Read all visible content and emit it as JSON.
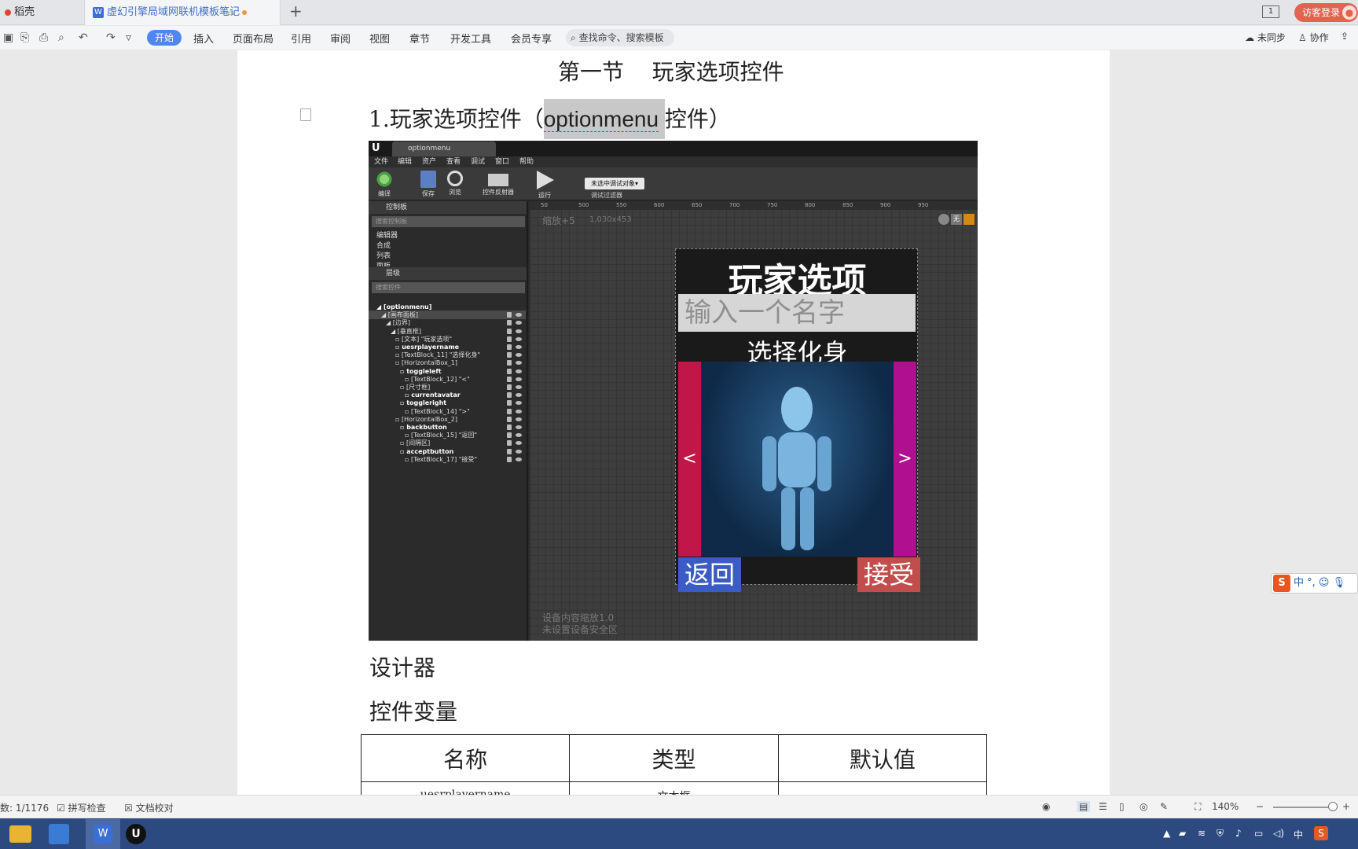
{
  "tabs": {
    "home": "稻壳",
    "doc": "虚幻引擎局域网联机模板笔记",
    "new_tab": "+"
  },
  "titlebar": {
    "window_count": "1",
    "visitor_login": "访客登录"
  },
  "ribbon": {
    "tabs": [
      "开始",
      "插入",
      "页面布局",
      "引用",
      "审阅",
      "视图",
      "章节",
      "开发工具",
      "会员专享"
    ],
    "search_placeholder": "查找命令、搜索模板",
    "sync": "未同步",
    "collab": "协作"
  },
  "document": {
    "section_title": "第一节    玩家选项控件",
    "heading_prefix": "1.玩家选项控件（",
    "heading_highlight": "optionmenu",
    "heading_suffix": "控件）",
    "caption_designer": "设计器",
    "caption_vars": "控件变量",
    "table": {
      "headers": [
        "名称",
        "类型",
        "默认值"
      ],
      "rows": [
        [
          "uesrplayername",
          "文本框",
          ""
        ]
      ]
    }
  },
  "ue_editor": {
    "tab_title": "optionmenu",
    "menu": [
      "文件",
      "编辑",
      "资产",
      "查看",
      "调试",
      "窗口",
      "帮助"
    ],
    "toolbar": [
      "编译",
      "保存",
      "浏览",
      "控件反射器",
      "运行"
    ],
    "debug_select": "未选中调试对象▾",
    "debug_filter": "调试过滤器",
    "palette_header": "控制板",
    "palette_search": "搜索控制板",
    "palette_items": [
      "编辑器",
      "合成",
      "列表",
      "面板"
    ],
    "hierarchy_header": "层级",
    "hierarchy_search": "搜索控件",
    "hierarchy": [
      "[optionmenu]",
      "[画布面板]",
      "[边界]",
      "[垂直框]",
      "[文本] \"玩家选项\"",
      "uesrplayername",
      "[TextBlock_11] \"选择化身\"",
      "[HorizontalBox_1]",
      "toggleleft",
      "[TextBlock_12] \"<\"",
      "[尺寸框]",
      "currentavatar",
      "toggleright",
      "[TextBlock_14] \">\"",
      "[HorizontalBox_2]",
      "backbutton",
      "[TextBlock_15] \"返回\"",
      "[间隔区]",
      "acceptbutton",
      "[TextBlock_17] \"接受\""
    ],
    "ruler_ticks": [
      "50",
      "500",
      "550",
      "600",
      "650",
      "700",
      "750",
      "800",
      "850",
      "900",
      "950"
    ],
    "zoom_label": "缩放+5",
    "canvas_size": "1,030x453",
    "device_scale": "设备内容缩放1.0",
    "safe_zone": "未设置设备安全区",
    "view_toggle": "无",
    "widget": {
      "title": "玩家选项",
      "input_hint": "输入一个名字",
      "choose": "选择化身",
      "left": "<",
      "right": ">",
      "back": "返回",
      "accept": "接受"
    }
  },
  "statusbar": {
    "page": "数: 1/1176",
    "spellcheck": "拼写检查",
    "proof": "文档校对",
    "zoom": "140%"
  },
  "ime": {
    "logo": "S",
    "text": "中 °,"
  },
  "tray": {
    "lang": "中"
  },
  "colors": {
    "accent": "#4f87ee",
    "visitor": "#e26350",
    "taskbar": "#2c4a80"
  }
}
